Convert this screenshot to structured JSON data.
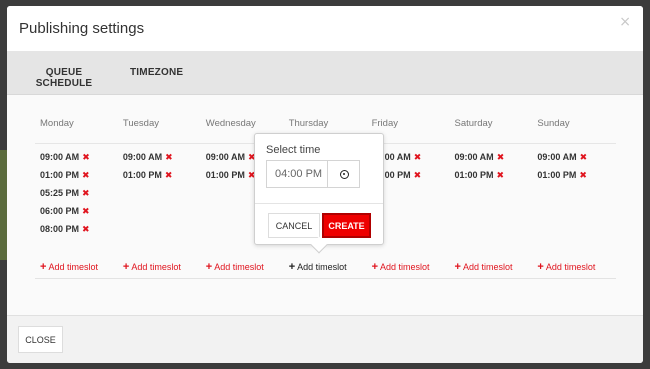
{
  "modal": {
    "title": "Publishing settings",
    "close_icon": "×"
  },
  "tabs": [
    {
      "label": "QUEUE SCHEDULE",
      "active": true
    },
    {
      "label": "TIMEZONE",
      "active": false
    }
  ],
  "days": [
    {
      "name": "Monday",
      "slots": [
        "09:00 AM",
        "01:00 PM",
        "05:25 PM",
        "06:00 PM",
        "08:00 PM"
      ]
    },
    {
      "name": "Tuesday",
      "slots": [
        "09:00 AM",
        "01:00 PM"
      ]
    },
    {
      "name": "Wednesday",
      "slots": [
        "09:00 AM",
        "01:00 PM"
      ]
    },
    {
      "name": "Thursday",
      "slots": []
    },
    {
      "name": "Friday",
      "slots": [
        "09:00 AM",
        "01:00 PM"
      ]
    },
    {
      "name": "Saturday",
      "slots": [
        "09:00 AM",
        "01:00 PM"
      ]
    },
    {
      "name": "Sunday",
      "slots": [
        "09:00 AM",
        "01:00 PM"
      ]
    }
  ],
  "add_timeslot_label": "Add timeslot",
  "remove_icon": "✖",
  "popover": {
    "label": "Select time",
    "time_value": "04:00 PM",
    "cancel_label": "CANCEL",
    "create_label": "CREATE"
  },
  "footer": {
    "close_label": "CLOSE"
  },
  "colors": {
    "accent": "#e0141e",
    "create_bg": "#ee0000"
  }
}
